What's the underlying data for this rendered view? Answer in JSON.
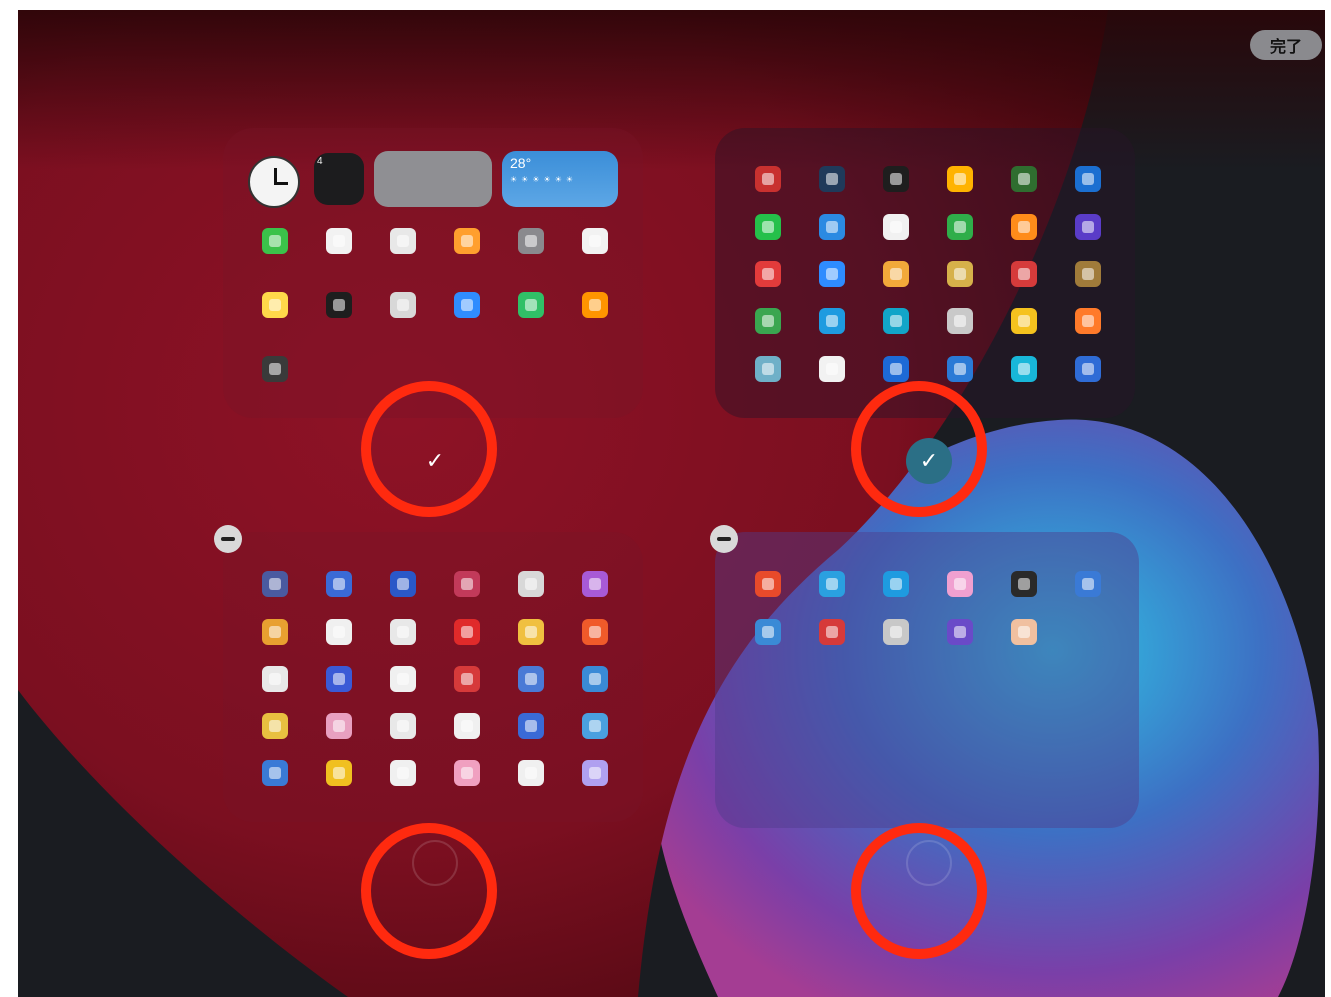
{
  "toolbar": {
    "done_label": "完了"
  },
  "widgets": {
    "calendar_day": "4",
    "weather_temp": "28°",
    "weather_row": "☀☀☀☀☀☀"
  },
  "pages": [
    {
      "id": "page-1",
      "checked": true
    },
    {
      "id": "page-2",
      "checked": true
    },
    {
      "id": "page-3",
      "checked": false
    },
    {
      "id": "page-4",
      "checked": false
    }
  ],
  "check_glyph": "✓",
  "highlight_color": "#ff2a0f"
}
